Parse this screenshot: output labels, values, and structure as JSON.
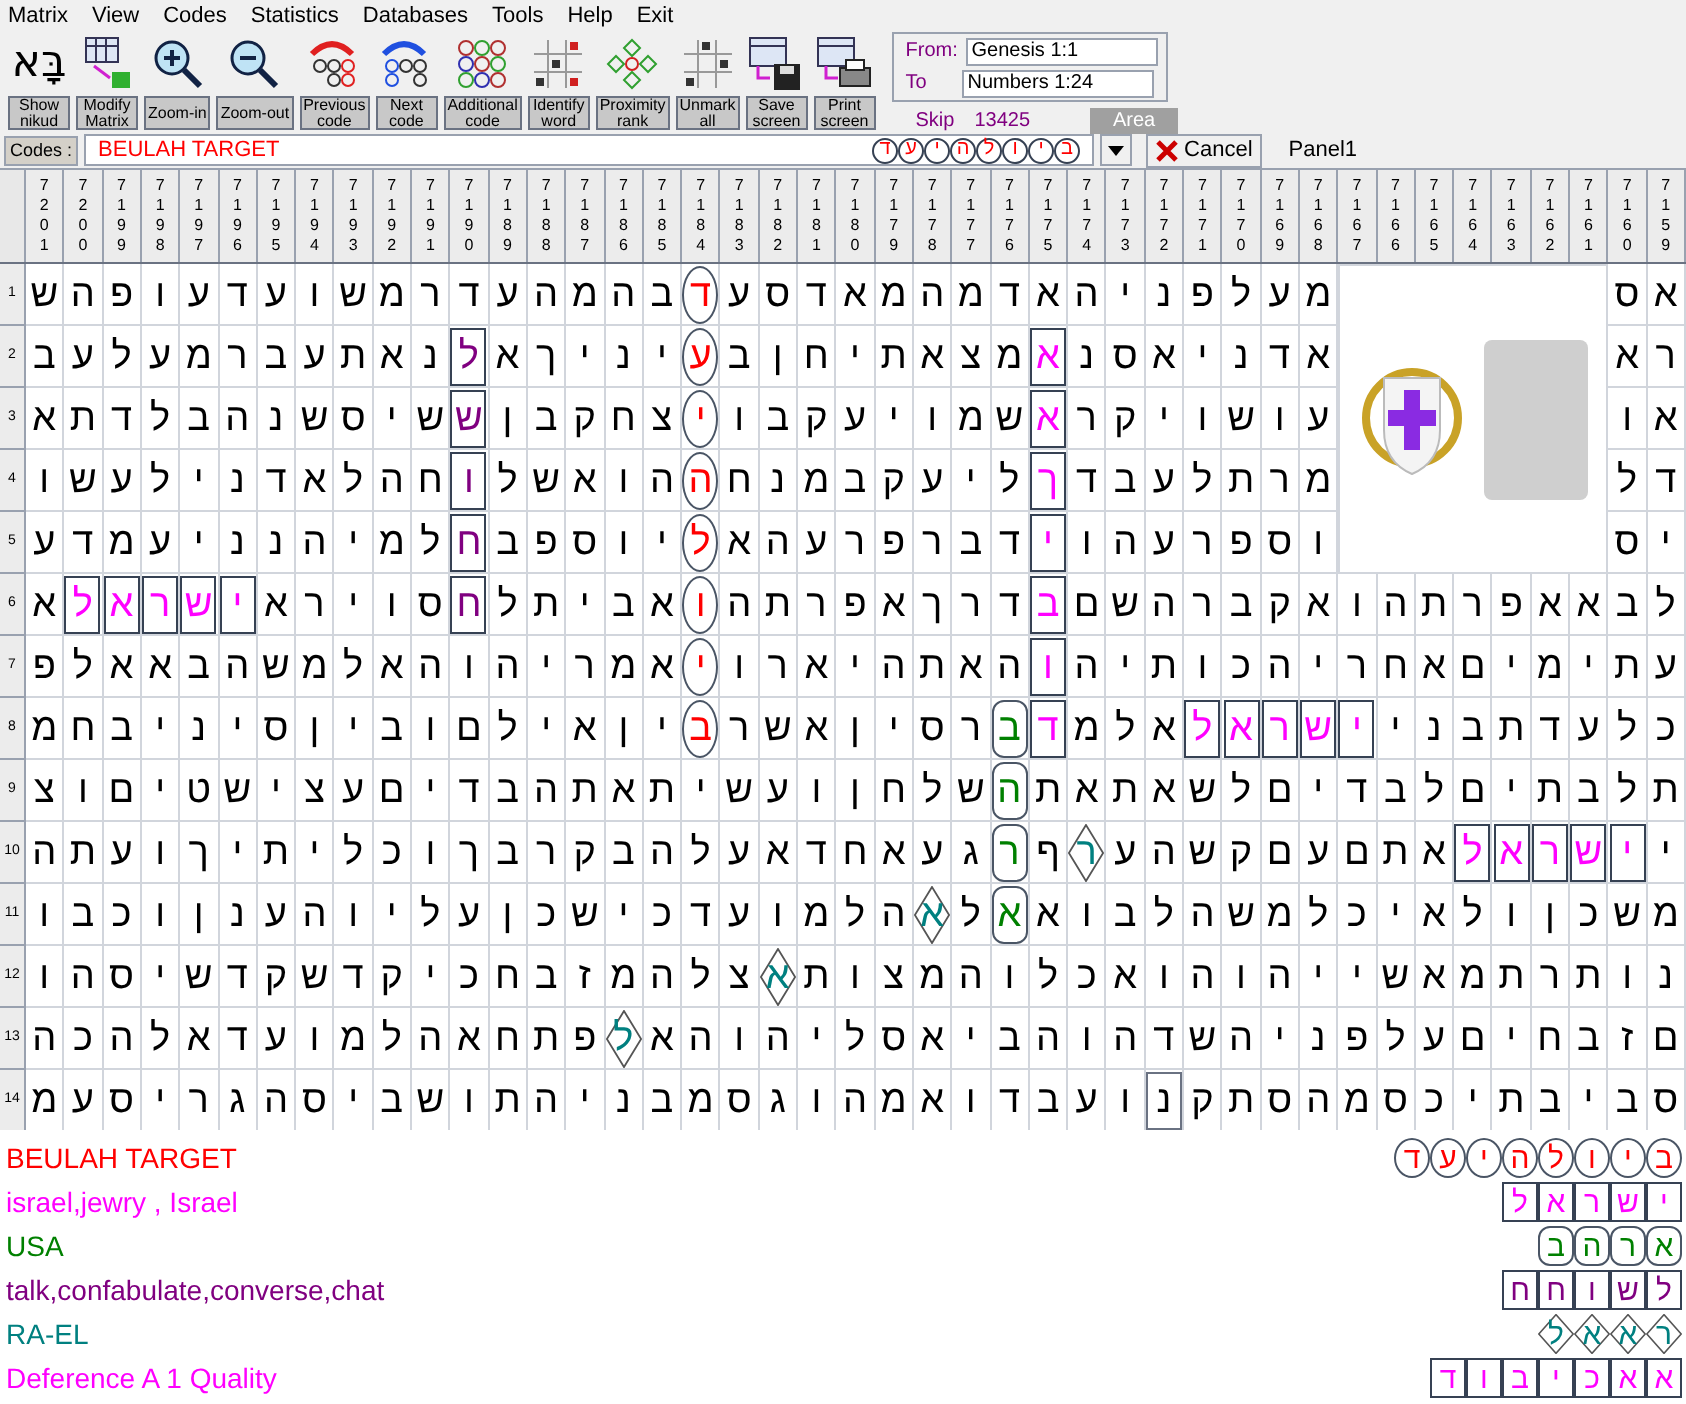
{
  "menu": [
    "Matrix",
    "View",
    "Codes",
    "Statistics",
    "Databases",
    "Tools",
    "Help",
    "Exit"
  ],
  "toolbar": {
    "buttons": [
      {
        "kind": "nikud",
        "glyph": "בָּא",
        "lines": [
          "Show",
          "nikud"
        ]
      },
      {
        "kind": "modify",
        "lines": [
          "Modify",
          "Matrix"
        ]
      },
      {
        "kind": "zoom-in",
        "lines": [
          "Zoom-in"
        ]
      },
      {
        "kind": "zoom-out",
        "lines": [
          "Zoom-out"
        ]
      },
      {
        "kind": "previous",
        "lines": [
          "Previous",
          "code"
        ]
      },
      {
        "kind": "next",
        "lines": [
          "Next",
          "code"
        ]
      },
      {
        "kind": "additional",
        "lines": [
          "Additional",
          "code"
        ]
      },
      {
        "kind": "identify",
        "lines": [
          "Identify",
          "word"
        ]
      },
      {
        "kind": "proximity",
        "lines": [
          "Proximity",
          "rank"
        ]
      },
      {
        "kind": "unmark",
        "lines": [
          "Unmark",
          "all"
        ]
      },
      {
        "kind": "save",
        "lines": [
          "Save",
          "screen"
        ]
      },
      {
        "kind": "print",
        "lines": [
          "Print",
          "screen"
        ]
      }
    ],
    "range": {
      "from_label": "From:",
      "from": "Genesis 1:1",
      "to_label": "To",
      "to": "Numbers 1:24",
      "skip_label": "Skip",
      "skip": "13425",
      "area": "Area"
    }
  },
  "codes": {
    "label": "Codes :",
    "value": "BEULAH TARGET",
    "letters": [
      "ב",
      "י",
      "ו",
      "ל",
      "ה",
      "י",
      "ע",
      "ד"
    ],
    "cancel": "Cancel",
    "panel": "Panel1"
  },
  "grid": {
    "columns": [
      "7201",
      "7200",
      "7199",
      "7198",
      "7197",
      "7196",
      "7195",
      "7194",
      "7193",
      "7192",
      "7191",
      "7190",
      "7189",
      "7188",
      "7187",
      "7186",
      "7185",
      "7184",
      "7183",
      "7182",
      "7181",
      "7180",
      "7179",
      "7178",
      "7177",
      "7176",
      "7175",
      "7174",
      "7173",
      "7172",
      "7171",
      "7170",
      "7169",
      "7168",
      "7167",
      "7166",
      "7165",
      "7164",
      "7163",
      "7162",
      "7161",
      "7160",
      "7159"
    ],
    "rows": [
      {
        "number": "1",
        "cells": [
          "ש",
          "ה",
          "פ",
          "ו",
          "ע",
          "ד",
          "ע",
          "ו",
          "ש",
          "מ",
          "ר",
          "ד",
          "ע",
          "ה",
          "מ",
          "ה",
          "ב",
          {
            "letter": "ד",
            "kind": "circle",
            "color": "#ff0000"
          },
          "ע",
          "ס",
          "ד",
          "א",
          "מ",
          "ה",
          "מ",
          "ד",
          "א",
          "ה",
          "י",
          "נ",
          "פ",
          "ל",
          "ע",
          "מ",
          null,
          null,
          null,
          null,
          null,
          null,
          null,
          "ס",
          "א"
        ]
      },
      {
        "number": "2",
        "cells": [
          "ב",
          "ע",
          "ל",
          "ע",
          "מ",
          "ר",
          "ב",
          "ע",
          "ת",
          "א",
          "נ",
          {
            "letter": "ל",
            "kind": "box",
            "color": "#800080"
          },
          "א",
          "ך",
          "י",
          "נ",
          "י",
          {
            "letter": "ע",
            "kind": "circle",
            "color": "#ff0000"
          },
          "ב",
          "ן",
          "ח",
          "י",
          "ת",
          "א",
          "צ",
          "מ",
          {
            "letter": "א",
            "kind": "box",
            "color": "#ff00ff"
          },
          "נ",
          "ס",
          "א",
          "י",
          "נ",
          "ד",
          "א",
          null,
          null,
          null,
          null,
          null,
          null,
          null,
          "א",
          "ר"
        ]
      },
      {
        "number": "3",
        "cells": [
          "א",
          "ת",
          "ד",
          "ל",
          "ב",
          "ה",
          "נ",
          "ש",
          "ס",
          "י",
          "ש",
          {
            "letter": "ש",
            "kind": "box",
            "color": "#800080"
          },
          "ן",
          "ב",
          "ק",
          "ח",
          "צ",
          {
            "letter": "י",
            "kind": "circle",
            "color": "#ff0000"
          },
          "ו",
          "ב",
          "ק",
          "ע",
          "י",
          "ו",
          "מ",
          "ש",
          {
            "letter": "א",
            "kind": "box",
            "color": "#ff00ff"
          },
          "ר",
          "ק",
          "י",
          "ו",
          "ש",
          "ו",
          "ע",
          null,
          null,
          null,
          null,
          null,
          null,
          null,
          "ו",
          "א"
        ]
      },
      {
        "number": "4",
        "cells": [
          "ו",
          "ש",
          "ע",
          "ל",
          "י",
          "נ",
          "ד",
          "א",
          "ל",
          "ה",
          "ח",
          {
            "letter": "ו",
            "kind": "box",
            "color": "#800080"
          },
          "ל",
          "ש",
          "א",
          "ו",
          "ה",
          {
            "letter": "ה",
            "kind": "circle",
            "color": "#ff0000"
          },
          "ח",
          "נ",
          "מ",
          "ב",
          "ק",
          "ע",
          "י",
          "ל",
          {
            "letter": "ך",
            "kind": "box",
            "color": "#ff00ff"
          },
          "ד",
          "ב",
          "ע",
          "ל",
          "ת",
          "ר",
          "מ",
          null,
          null,
          null,
          null,
          null,
          null,
          null,
          "ל",
          "ד"
        ]
      },
      {
        "number": "5",
        "cells": [
          "ע",
          "ד",
          "מ",
          "ע",
          "י",
          "נ",
          "נ",
          "ה",
          "י",
          "מ",
          "ל",
          {
            "letter": "ח",
            "kind": "box",
            "color": "#800080"
          },
          "ב",
          "פ",
          "ס",
          "ו",
          "י",
          {
            "letter": "ל",
            "kind": "circle",
            "color": "#ff0000"
          },
          "א",
          "ה",
          "ע",
          "ר",
          "פ",
          "ר",
          "ב",
          "ד",
          {
            "letter": "י",
            "kind": "box",
            "color": "#ff00ff"
          },
          "ו",
          "ה",
          "ע",
          "ר",
          "פ",
          "ס",
          "ו",
          null,
          null,
          null,
          null,
          null,
          null,
          null,
          "ס",
          "י"
        ]
      },
      {
        "number": "6",
        "cells": [
          "א",
          {
            "letter": "ל",
            "kind": "box",
            "color": "#ff00ff"
          },
          {
            "letter": "א",
            "kind": "box",
            "color": "#ff00ff"
          },
          {
            "letter": "ר",
            "kind": "box",
            "color": "#ff00ff"
          },
          {
            "letter": "ש",
            "kind": "box",
            "color": "#ff00ff"
          },
          {
            "letter": "י",
            "kind": "box",
            "color": "#ff00ff"
          },
          "א",
          "ר",
          "י",
          "ו",
          "ס",
          {
            "letter": "ח",
            "kind": "box",
            "color": "#800080"
          },
          "ל",
          "ת",
          "י",
          "ב",
          "א",
          {
            "letter": "ו",
            "kind": "circle",
            "color": "#ff0000"
          },
          "ה",
          "ת",
          "ר",
          "פ",
          "א",
          "ך",
          "ר",
          "ד",
          {
            "letter": "ב",
            "kind": "box",
            "color": "#ff00ff"
          },
          "ם",
          "ש",
          "ה",
          "ר",
          "ב",
          "ק",
          "א",
          "ו",
          "ה",
          "ת",
          "ר",
          "פ",
          "א",
          "א",
          "ב",
          "ל"
        ]
      },
      {
        "number": "7",
        "cells": [
          "פ",
          "ל",
          "א",
          "א",
          "ב",
          "ה",
          "ש",
          "מ",
          "ל",
          "א",
          "ה",
          "ו",
          "ה",
          "י",
          "ר",
          "מ",
          "א",
          {
            "letter": "י",
            "kind": "circle",
            "color": "#ff0000"
          },
          "ו",
          "ר",
          "א",
          "י",
          "ה",
          "ת",
          "א",
          "ה",
          {
            "letter": "ו",
            "kind": "box",
            "color": "#ff00ff"
          },
          "ה",
          "י",
          "ת",
          "ו",
          "כ",
          "ה",
          "י",
          "ר",
          "ח",
          "א",
          "ם",
          "י",
          "מ",
          "י",
          "ת",
          "ע"
        ]
      },
      {
        "number": "8",
        "cells": [
          "מ",
          "ח",
          "ב",
          "י",
          "נ",
          "י",
          "ס",
          "ן",
          "י",
          "ב",
          "ו",
          "ם",
          "ל",
          "י",
          "א",
          "ן",
          "י",
          {
            "letter": "ב",
            "kind": "circle",
            "color": "#ff0000"
          },
          "ר",
          "ש",
          "א",
          "ן",
          "י",
          "ס",
          "ר",
          {
            "letter": "ב",
            "kind": "rounded",
            "color": "#008000"
          },
          {
            "letter": "ד",
            "kind": "box",
            "color": "#ff00ff"
          },
          "מ",
          "ל",
          "א",
          {
            "letter": "ל",
            "kind": "box",
            "color": "#ff00ff"
          },
          {
            "letter": "א",
            "kind": "box",
            "color": "#ff00ff"
          },
          {
            "letter": "ר",
            "kind": "box",
            "color": "#ff00ff"
          },
          {
            "letter": "ש",
            "kind": "box",
            "color": "#ff00ff"
          },
          {
            "letter": "י",
            "kind": "box",
            "color": "#ff00ff"
          },
          "י",
          "נ",
          "ב",
          "ת",
          "ד",
          "ע",
          "ל",
          "כ"
        ]
      },
      {
        "number": "9",
        "cells": [
          "צ",
          "ו",
          "ם",
          "י",
          "ט",
          "ש",
          "י",
          "צ",
          "ע",
          "ם",
          "י",
          "ד",
          "ב",
          "ה",
          "ת",
          "א",
          "ת",
          "י",
          "ש",
          "ע",
          "ו",
          "ן",
          "ח",
          "ל",
          "ש",
          {
            "letter": "ה",
            "kind": "rounded",
            "color": "#008000"
          },
          "ת",
          "א",
          "ת",
          "א",
          "ש",
          "ל",
          "ם",
          "י",
          "ד",
          "ב",
          "ל",
          "ם",
          "י",
          "ת",
          "ב",
          "ל",
          "ת"
        ]
      },
      {
        "number": "10",
        "cells": [
          "ה",
          "ת",
          "ע",
          "ו",
          "ך",
          "י",
          "ת",
          "י",
          "ל",
          "כ",
          "ו",
          "ך",
          "ב",
          "ר",
          "ק",
          "ב",
          "ה",
          "ל",
          "ע",
          "א",
          "ד",
          "ח",
          "א",
          "ע",
          "ג",
          {
            "letter": "ר",
            "kind": "rounded",
            "color": "#008000"
          },
          "ף",
          {
            "letter": "ר",
            "kind": "diamond",
            "color": "#008080"
          },
          "ע",
          "ה",
          "ש",
          "ק",
          "ם",
          "ע",
          "ם",
          "ת",
          "א",
          {
            "letter": "ל",
            "kind": "box",
            "color": "#ff00ff"
          },
          {
            "letter": "א",
            "kind": "box",
            "color": "#ff00ff"
          },
          {
            "letter": "ר",
            "kind": "box",
            "color": "#ff00ff"
          },
          {
            "letter": "ש",
            "kind": "box",
            "color": "#ff00ff"
          },
          {
            "letter": "י",
            "kind": "box",
            "color": "#ff00ff"
          },
          "י"
        ]
      },
      {
        "number": "11",
        "cells": [
          "ו",
          "ב",
          "כ",
          "ו",
          "ן",
          "נ",
          "ע",
          "ה",
          "ו",
          "י",
          "ל",
          "ע",
          "ן",
          "כ",
          "ש",
          "י",
          "כ",
          "ד",
          "ע",
          "ו",
          "מ",
          "ל",
          "ה",
          {
            "letter": "א",
            "kind": "diamond",
            "color": "#008080"
          },
          "ל",
          {
            "letter": "א",
            "kind": "rounded",
            "color": "#008000"
          },
          "א",
          "ו",
          "ב",
          "ל",
          "ה",
          "ש",
          "מ",
          "ל",
          "כ",
          "י",
          "א",
          "ל",
          "ו",
          "ן",
          "כ",
          "ש",
          "מ"
        ]
      },
      {
        "number": "12",
        "cells": [
          "ו",
          "ה",
          "ס",
          "י",
          "ש",
          "ד",
          "ק",
          "ש",
          "ד",
          "ק",
          "י",
          "כ",
          "ח",
          "ב",
          "ז",
          "מ",
          "ה",
          "ל",
          "צ",
          {
            "letter": "א",
            "kind": "diamond",
            "color": "#008080"
          },
          "ת",
          "ו",
          "צ",
          "מ",
          "ה",
          "ו",
          "ל",
          "כ",
          "א",
          "ו",
          "ה",
          "ו",
          "ה",
          "י",
          "י",
          "ש",
          "א",
          "מ",
          "ת",
          "ר",
          "ת",
          "ו",
          "נ"
        ]
      },
      {
        "number": "13",
        "cells": [
          "ה",
          "כ",
          "ה",
          "ל",
          "א",
          "ד",
          "ע",
          "ו",
          "מ",
          "ל",
          "ה",
          "א",
          "ח",
          "ת",
          "פ",
          {
            "letter": "ל",
            "kind": "diamond",
            "color": "#008080"
          },
          "א",
          "ה",
          "ו",
          "ה",
          "י",
          "ל",
          "ס",
          "א",
          "י",
          "ב",
          "ה",
          "ו",
          "ה",
          "ד",
          "ש",
          "ה",
          "י",
          "נ",
          "פ",
          "ל",
          "ע",
          "ם",
          "י",
          "ח",
          "ב",
          "ז",
          "ם"
        ]
      },
      {
        "number": "14",
        "cells": [
          "מ",
          "ע",
          "ס",
          "י",
          "ר",
          "ג",
          "ה",
          "ס",
          "י",
          "ב",
          "ש",
          "ו",
          "ת",
          "ה",
          "י",
          "נ",
          "ב",
          "מ",
          "ס",
          "ג",
          "ו",
          "ה",
          "מ",
          "א",
          "ו",
          "ד",
          "ב",
          "ע",
          "ו",
          {
            "letter": "נ",
            "kind": "cursor"
          },
          "ק",
          "ת",
          "ס",
          "ה",
          "מ",
          "ס",
          "כ",
          "י",
          "ת",
          "ב",
          "י",
          "ב",
          "ס"
        ]
      }
    ]
  },
  "legend": [
    {
      "label": "BEULAH TARGET",
      "color": "#ff0000",
      "kind": "circle",
      "letters": [
        "ב",
        "י",
        "ו",
        "ל",
        "ה",
        "י",
        "ע",
        "ד"
      ]
    },
    {
      "label": "israel,jewry , Israel",
      "color": "#ff00ff",
      "kind": "box",
      "letters": [
        "י",
        "ש",
        "ר",
        "א",
        "ל"
      ]
    },
    {
      "label": "USA",
      "color": "#008000",
      "kind": "rounded",
      "letters": [
        "א",
        "ר",
        "ה",
        "ב"
      ]
    },
    {
      "label": "talk,confabulate,converse,chat",
      "color": "#800080",
      "kind": "box",
      "letters": [
        "ל",
        "ש",
        "ו",
        "ח",
        "ח"
      ]
    },
    {
      "label": "RA-EL",
      "color": "#008080",
      "kind": "diamond",
      "letters": [
        "ר",
        "א",
        "א",
        "ל"
      ]
    },
    {
      "label": "Deference A 1 Quality",
      "color": "#ff00ff",
      "kind": "box",
      "letters": [
        "א",
        "א",
        "כ",
        "י",
        "ב",
        "ו",
        "ד"
      ]
    }
  ]
}
